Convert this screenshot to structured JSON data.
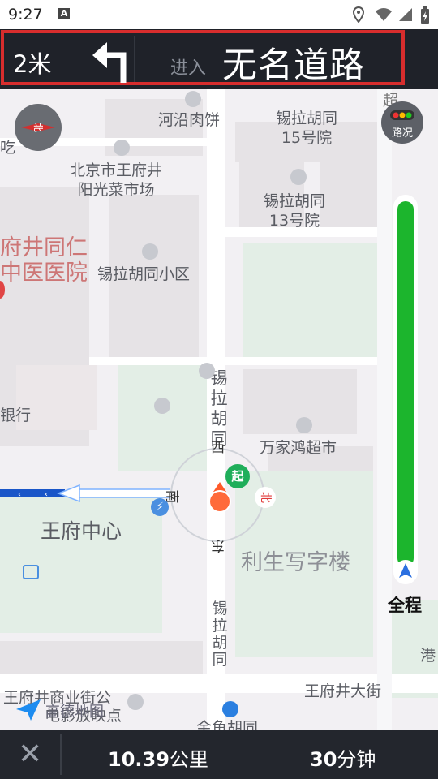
{
  "status": {
    "time": "9:27",
    "a_badge": "A"
  },
  "nav": {
    "distance": "2米",
    "enter_label": "进入",
    "road_name": "无名道路",
    "frame_color": "#d72d2d"
  },
  "map": {
    "labels": {
      "heyan": "河沿肉饼",
      "xila15": "锡拉胡同\n15号院",
      "chi": "吃",
      "market": "北京市王府井\n阳光菜市场",
      "xila13": "锡拉胡同\n13号院",
      "hospital": "府井同仁\n中医医院",
      "xiaoqu": "锡拉胡同小区",
      "bank": "银行",
      "xila_vertical": "锡拉胡同",
      "xi": "西",
      "supermarket": "万家鸿超市",
      "wangfu_center": "王府中心",
      "nan": "南",
      "bei": "北",
      "dong": "东",
      "lisheng": "利生写字楼",
      "xila_vertical2": "锡拉胡同",
      "gang": "港",
      "wangfujing_commercial": "王府井商业街公",
      "cinema": "电影放映点",
      "wangfujing_ave": "王府井大街",
      "jinyu": "金鱼胡同",
      "chao": "超",
      "start_badge": "起",
      "amap_logo": "高德地图"
    },
    "traffic_button_label": "路况",
    "compass_label": "北",
    "full_route_label": "全程",
    "traffic_color": "#1cb52d"
  },
  "bottom": {
    "close_label": "✕",
    "distance_value": "10.39",
    "distance_unit": "公里",
    "time_value": "30",
    "time_unit": "分钟"
  }
}
